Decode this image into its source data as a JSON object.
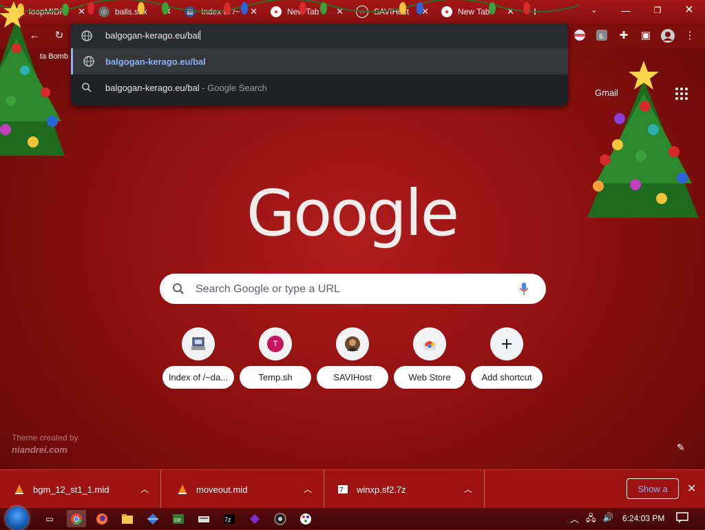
{
  "tabs": [
    {
      "title": "loopMIDI",
      "icon": "loopmidi-icon"
    },
    {
      "title": "balls.sex",
      "icon": "globe-icon"
    },
    {
      "title": "Index of /~",
      "icon": "server-icon"
    },
    {
      "title": "New Tab",
      "icon": "chrome-icon"
    },
    {
      "title": "SAVIHost",
      "icon": "headphones-icon"
    },
    {
      "title": "New Tab",
      "icon": "chrome-icon"
    }
  ],
  "bookmarks": {
    "item": "ta Bomb"
  },
  "omnibox": {
    "input_value": "balgogan-kerago.eu/bal",
    "suggestions": [
      {
        "text": "balgogan-kerago.eu/bal",
        "sub": ""
      },
      {
        "text": "balgogan-kerago.eu/bal",
        "sub": " - Google Search"
      }
    ]
  },
  "header": {
    "gmail": "Gmail"
  },
  "logo": "Google",
  "search": {
    "placeholder": "Search Google or type a URL"
  },
  "shortcuts": [
    {
      "label": "Index of /~da...",
      "icon": "server-icon"
    },
    {
      "label": "Temp.sh",
      "icon": "letter-t-icon",
      "letter": "T"
    },
    {
      "label": "SAVIHost",
      "icon": "avatar-icon"
    },
    {
      "label": "Web Store",
      "icon": "web-store-icon"
    },
    {
      "label": "Add shortcut",
      "icon": "plus-icon"
    }
  ],
  "theme_credit": {
    "line1": "Theme created by",
    "line2": "niandrei.com"
  },
  "downloads": [
    {
      "name": "bgm_12_st1_1.mid",
      "icon": "vlc-icon"
    },
    {
      "name": "moveout.mid",
      "icon": "vlc-icon"
    },
    {
      "name": "winxp.sf2.7z",
      "icon": "archive-icon"
    }
  ],
  "shelf": {
    "show_all": "Show a"
  },
  "taskbar": {
    "clock": "6:24:03 PM"
  },
  "colors": {
    "accent": "#8ab4f8",
    "background": "#8e1010",
    "omnibox": "#202124"
  }
}
